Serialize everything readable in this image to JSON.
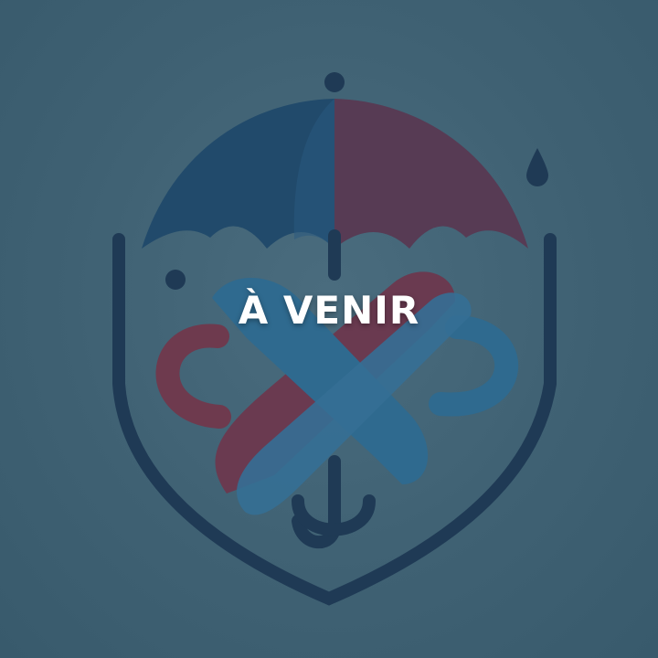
{
  "overlay": {
    "text": "À VENIR"
  },
  "logo": {
    "icon": "umbrella-shield-logo-icon",
    "colors": {
      "background": "#3f6173",
      "navy": "#1f3a55",
      "blue": "#2f6a8f",
      "plum": "#5a3a52",
      "maroon": "#6e3a4e"
    }
  }
}
